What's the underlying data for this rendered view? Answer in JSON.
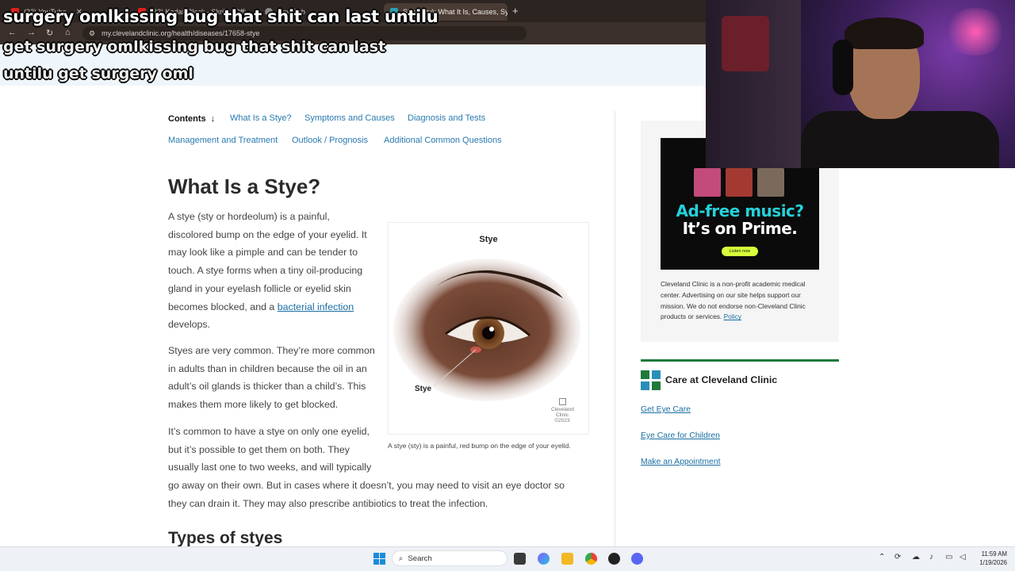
{
  "browser": {
    "tabs": [
      {
        "title": "(32) YouTube",
        "active": false
      },
      {
        "title": "(32) Kodak Black - Skrilla [Offi",
        "active": false
      },
      {
        "title": "New Tab",
        "active": false
      },
      {
        "title": "Stye (Sty): What It Is, Causes, Sy",
        "active": true
      }
    ],
    "url": "my.clevelandclinic.org/health/diseases/17658-stye"
  },
  "overlay": {
    "line1": "surgery omlkissing bug that shit can last untilu",
    "line2": "get surgery omlkissing bug that shit can last",
    "line3": "untilu get surgery oml"
  },
  "contents_nav": {
    "label": "Contents",
    "links": [
      "What Is a Stye?",
      "Symptoms and Causes",
      "Diagnosis and Tests",
      "Management and Treatment",
      "Outlook / Prognosis",
      "Additional Common Questions"
    ]
  },
  "article": {
    "title": "What Is a Stye?",
    "p1_before": "A stye (sty or hordeolum) is a painful, discolored bump on the edge of your eyelid. It may look like a pimple and can be tender to touch. A stye forms when a tiny oil-producing gland in your eyelash follicle or eyelid skin becomes blocked, and a ",
    "p1_link": "bacterial infection",
    "p1_after": " develops.",
    "p2": "Styes are very common. They’re more common in adults than in children because the oil in an adult’s oil glands is thicker than a child’s. This makes them more likely to get blocked.",
    "p3a": "It’s common to have a stye on only one eyelid, but it’s possible to get them on both. They usually last one to two weeks, and will typically",
    "p3b": "go away on their own. But in cases where it doesn’t, you may need to visit an eye doctor so they can drain it. They may also prescribe antibiotics to treat the infection.",
    "h2": "Types of styes",
    "figure": {
      "title": "Stye",
      "label": "Stye",
      "logo_line1": "Cleveland",
      "logo_line2": "Clinic",
      "logo_line3": "©2023",
      "caption": "A stye (sty) is a painful, red bump on the edge of your eyelid."
    }
  },
  "sidebar": {
    "ad": {
      "headline": "Ad-free music?",
      "subline": "It’s on Prime.",
      "button": "Listen now"
    },
    "ad_note": "Cleveland Clinic is a non-profit academic medical center. Advertising on our site helps support our mission. We do not endorse non-Cleveland Clinic products or services. ",
    "ad_note_link": "Policy",
    "care_title": "Care at Cleveland Clinic",
    "care_links": [
      "Get Eye Care",
      "Eye Care for Children",
      "Make an Appointment"
    ],
    "accent": "#1f7a3c"
  },
  "taskbar": {
    "search_placeholder": "Search",
    "time": "11:59 AM",
    "date": "1/19/2026"
  }
}
